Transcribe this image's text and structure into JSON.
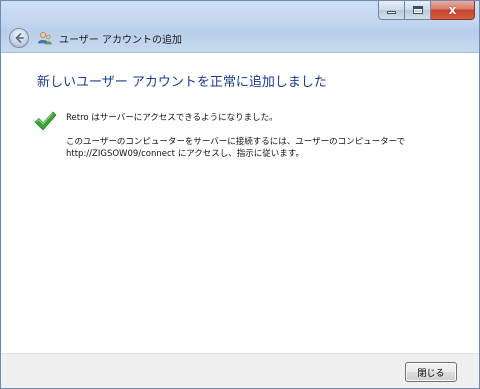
{
  "window": {
    "title": "ユーザー アカウントの追加",
    "caption_buttons": {
      "minimize_icon": "minimize-icon",
      "maximize_icon": "maximize-icon",
      "close_label": "x"
    }
  },
  "content": {
    "heading": "新しいユーザー アカウントを正常に追加しました",
    "status_icon": "check-icon",
    "line1": "Retro  はサーバーにアクセスできるようになりました。",
    "line2": "このユーザーのコンピューターをサーバーに接続するには、ユーザーのコンピューターで",
    "line3": "http://ZIGSOW09/connect にアクセスし、指示に従います。"
  },
  "footer": {
    "close_button_label": "閉じる"
  },
  "colors": {
    "heading": "#1a3c8e",
    "titlebar": "#c3d6ee",
    "check": "#3aa335",
    "close_caption": "#c5432c"
  }
}
